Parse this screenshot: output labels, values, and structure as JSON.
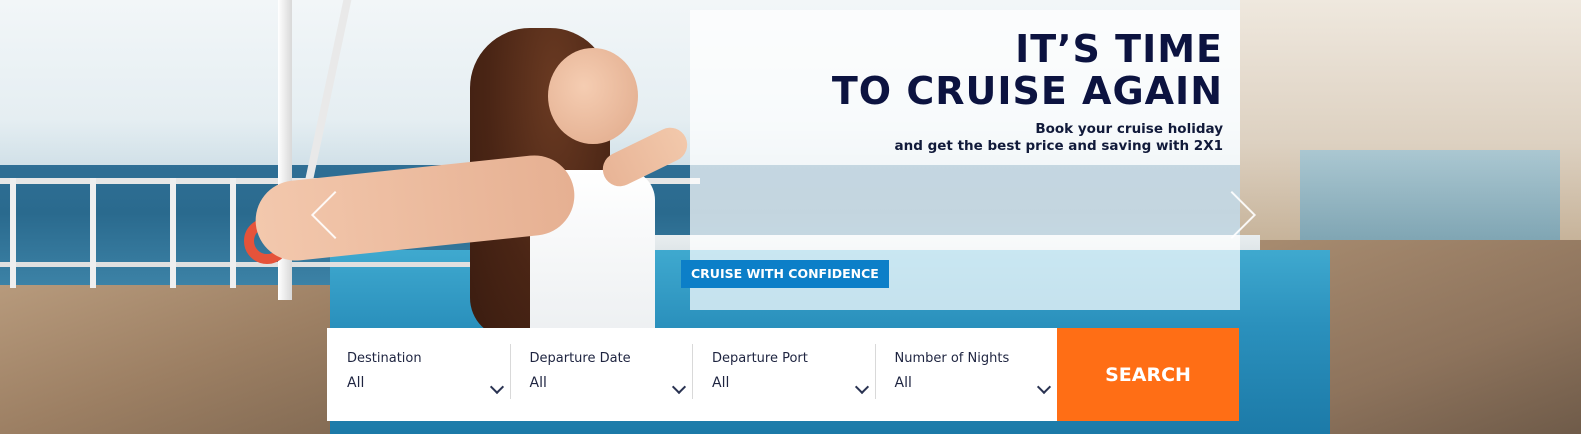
{
  "hero": {
    "headline_line1": "IT’S TIME",
    "headline_line2": "TO CRUISE AGAIN",
    "subtitle_line1": "Book your cruise holiday",
    "subtitle_line2": "and get the best price and saving with 2X1",
    "badge": "CRUISE WITH CONFIDENCE",
    "prev_icon": "chevron-left-icon",
    "next_icon": "chevron-right-icon"
  },
  "search": {
    "fields": [
      {
        "label": "Destination",
        "value": "All"
      },
      {
        "label": "Departure Date",
        "value": "All"
      },
      {
        "label": "Departure Port",
        "value": "All"
      },
      {
        "label": "Number of Nights",
        "value": "All"
      }
    ],
    "button_label": "SEARCH",
    "button_color": "#ff6e15"
  },
  "colors": {
    "headline": "#0c1340",
    "badge": "#0c7fc8"
  }
}
